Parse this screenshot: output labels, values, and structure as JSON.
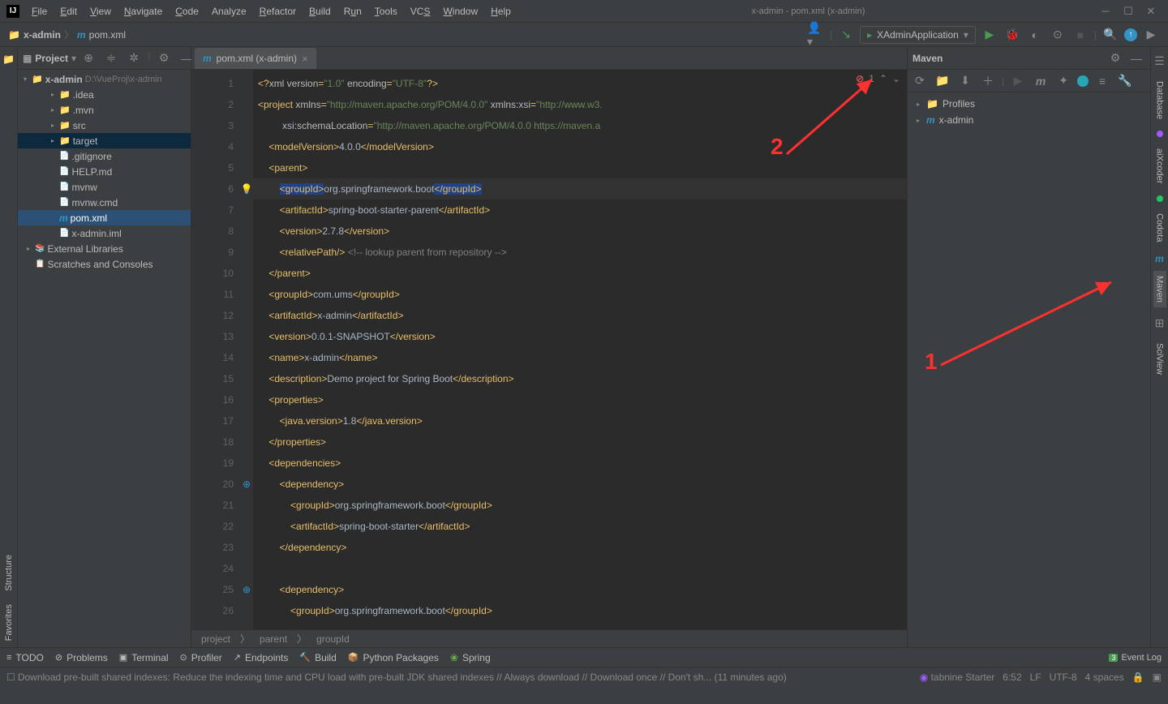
{
  "window": {
    "title": "x-admin - pom.xml (x-admin)"
  },
  "menu": {
    "file": "File",
    "edit": "Edit",
    "view": "View",
    "navigate": "Navigate",
    "code": "Code",
    "analyze": "Analyze",
    "refactor": "Refactor",
    "build": "Build",
    "run": "Run",
    "tools": "Tools",
    "vcs": "VCS",
    "window": "Window",
    "help": "Help"
  },
  "breadcrumb": {
    "root": "x-admin",
    "file": "pom.xml"
  },
  "run_config": {
    "label": "XAdminApplication"
  },
  "project": {
    "title": "Project",
    "root": {
      "name": "x-admin",
      "path": "D:\\VueProj\\x-admin"
    },
    "items": [
      {
        "name": ".idea",
        "d": 2
      },
      {
        "name": ".mvn",
        "d": 2
      },
      {
        "name": "src",
        "d": 2
      },
      {
        "name": "target",
        "d": 2,
        "orange": true,
        "hl": true
      },
      {
        "name": ".gitignore",
        "d": 2,
        "file": true
      },
      {
        "name": "HELP.md",
        "d": 2,
        "file": true
      },
      {
        "name": "mvnw",
        "d": 2,
        "file": true
      },
      {
        "name": "mvnw.cmd",
        "d": 2,
        "file": true
      },
      {
        "name": "pom.xml",
        "d": 2,
        "file": true,
        "sel": true
      },
      {
        "name": "x-admin.iml",
        "d": 2,
        "file": true
      }
    ],
    "ext_lib": "External Libraries",
    "scratch": "Scratches and Consoles"
  },
  "tab": {
    "label": "pom.xml (x-admin)"
  },
  "error_count": "1",
  "editor_breadcrumb": {
    "a": "project",
    "b": "parent",
    "c": "groupId"
  },
  "maven": {
    "title": "Maven",
    "profiles": "Profiles",
    "module": "x-admin"
  },
  "right_tabs": {
    "database": "Database",
    "aix": "aiXcoder",
    "codota": "Codota",
    "maven": "Maven",
    "sciview": "SciView"
  },
  "left_tabs": {
    "structure": "Structure",
    "favorites": "Favorites"
  },
  "bottom": {
    "todo": "TODO",
    "problems": "Problems",
    "terminal": "Terminal",
    "profiler": "Profiler",
    "endpoints": "Endpoints",
    "build": "Build",
    "pypkg": "Python Packages",
    "spring": "Spring",
    "eventlog": "Event Log"
  },
  "status": {
    "msg": "Download pre-built shared indexes: Reduce the indexing time and CPU load with pre-built JDK shared indexes // Always download // Download once // Don't sh... (11 minutes ago)",
    "tabnine": "tabnine Starter",
    "time": "6:52",
    "enc": "LF",
    "charset": "UTF-8",
    "indent": "4 spaces"
  },
  "annotations": {
    "one": "1",
    "two": "2"
  },
  "code_lines": [
    {
      "n": 1,
      "html": "<span class='tag'>&lt;?</span><span class='attr'>xml version</span><span class='tag'>=</span><span class='str'>\"1.0\"</span> <span class='attr'>encoding</span><span class='tag'>=</span><span class='str'>\"UTF-8\"</span><span class='tag'>?&gt;</span>"
    },
    {
      "n": 2,
      "html": "<span class='tag'>&lt;project </span><span class='attr'>xmlns</span><span class='tag'>=</span><span class='str'>\"http://maven.apache.org/POM/4.0.0\"</span> <span class='attr'>xmlns:</span><span class='txt'>xsi</span><span class='tag'>=</span><span class='str'>\"http://www.w3.</span>"
    },
    {
      "n": 3,
      "html": "         <span class='txt'>xsi</span><span class='attr'>:schemaLocation</span><span class='tag'>=</span><span class='str'>\"http://maven.apache.org/POM/4.0.0 https://maven.a</span>"
    },
    {
      "n": 4,
      "html": "    <span class='tag'>&lt;modelVersion&gt;</span><span class='txt'>4.0.0</span><span class='tag'>&lt;/modelVersion&gt;</span>"
    },
    {
      "n": 5,
      "html": "    <span class='tag'>&lt;parent&gt;</span>"
    },
    {
      "n": 6,
      "html": "        <span class='sel-bg'><span class='tag'>&lt;groupId&gt;</span></span><span class='txt'>org.springframework.boot</span><span class='sel-bg'><span class='tag'>&lt;/groupId&gt;</span></span>",
      "current": true,
      "bulb": true
    },
    {
      "n": 7,
      "html": "        <span class='tag'>&lt;artifactId&gt;</span><span class='txt'>spring-boot-starter-parent</span><span class='tag'>&lt;/artifactId&gt;</span>"
    },
    {
      "n": 8,
      "html": "        <span class='tag'>&lt;version&gt;</span><span class='txt'>2.7.8</span><span class='tag'>&lt;/version&gt;</span>"
    },
    {
      "n": 9,
      "html": "        <span class='tag'>&lt;relativePath/&gt;</span> <span class='cmt'>&lt;!-- lookup parent from repository --&gt;</span>"
    },
    {
      "n": 10,
      "html": "    <span class='tag'>&lt;/parent&gt;</span>"
    },
    {
      "n": 11,
      "html": "    <span class='tag'>&lt;groupId&gt;</span><span class='txt'>com.ums</span><span class='tag'>&lt;/groupId&gt;</span>"
    },
    {
      "n": 12,
      "html": "    <span class='tag'>&lt;artifactId&gt;</span><span class='txt'>x-admin</span><span class='tag'>&lt;/artifactId&gt;</span>"
    },
    {
      "n": 13,
      "html": "    <span class='tag'>&lt;version&gt;</span><span class='txt'>0.0.1-SNAPSHOT</span><span class='tag'>&lt;/version&gt;</span>"
    },
    {
      "n": 14,
      "html": "    <span class='tag'>&lt;name&gt;</span><span class='txt'>x-admin</span><span class='tag'>&lt;/name&gt;</span>"
    },
    {
      "n": 15,
      "html": "    <span class='tag'>&lt;description&gt;</span><span class='txt'>Demo project for Spring Boot</span><span class='tag'>&lt;/description&gt;</span>"
    },
    {
      "n": 16,
      "html": "    <span class='tag'>&lt;properties&gt;</span>"
    },
    {
      "n": 17,
      "html": "        <span class='tag'>&lt;java.version&gt;</span><span class='txt'>1.8</span><span class='tag'>&lt;/java.version&gt;</span>"
    },
    {
      "n": 18,
      "html": "    <span class='tag'>&lt;/properties&gt;</span>"
    },
    {
      "n": 19,
      "html": "    <span class='tag'>&lt;dependencies&gt;</span>"
    },
    {
      "n": 20,
      "html": "        <span class='tag'>&lt;dependency&gt;</span>",
      "badge": true
    },
    {
      "n": 21,
      "html": "            <span class='tag'>&lt;groupId&gt;</span><span class='txt'>org.springframework.boot</span><span class='tag'>&lt;/groupId&gt;</span>"
    },
    {
      "n": 22,
      "html": "            <span class='tag'>&lt;artifactId&gt;</span><span class='txt'>spring-boot-starter</span><span class='tag'>&lt;/artifactId&gt;</span>"
    },
    {
      "n": 23,
      "html": "        <span class='tag'>&lt;/dependency&gt;</span>"
    },
    {
      "n": 24,
      "html": ""
    },
    {
      "n": 25,
      "html": "        <span class='tag'>&lt;dependency&gt;</span>",
      "badge": true
    },
    {
      "n": 26,
      "html": "            <span class='tag'>&lt;groupId&gt;</span><span class='txt'>org.springframework.boot</span><span class='tag'>&lt;/groupId&gt;</span>"
    }
  ]
}
